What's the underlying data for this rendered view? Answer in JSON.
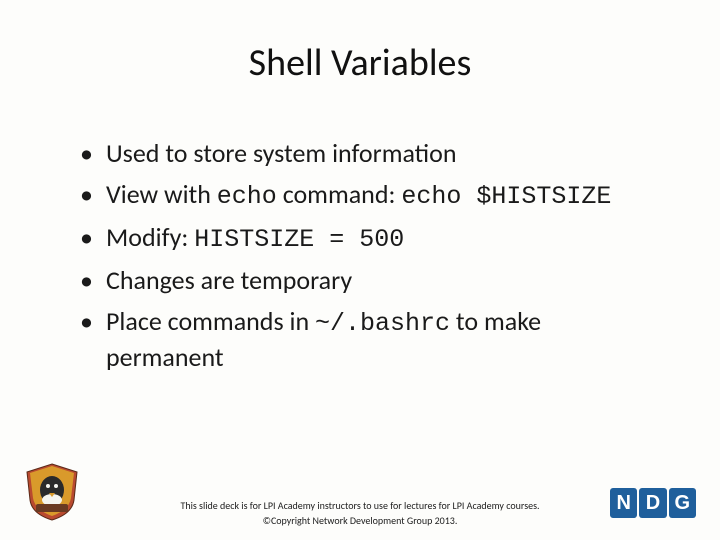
{
  "title": "Shell Variables",
  "bullets": [
    {
      "pre": "Used to store system information",
      "code1": "",
      "mid": "",
      "code2": "",
      "post": ""
    },
    {
      "pre": "View with ",
      "code1": "echo",
      "mid": " command: ",
      "code2": "echo $HISTSIZE",
      "post": ""
    },
    {
      "pre": "Modify: ",
      "code1": "HISTSIZE = 500",
      "mid": "",
      "code2": "",
      "post": ""
    },
    {
      "pre": "Changes are temporary",
      "code1": "",
      "mid": "",
      "code2": "",
      "post": ""
    },
    {
      "pre": "Place commands in ",
      "code1": "~/.bashrc",
      "mid": "",
      "code2": "",
      "post": " to make permanent"
    }
  ],
  "footer": {
    "line1": "This slide deck is for LPI Academy instructors to use for lectures for LPI Academy courses.",
    "line2": "©Copyright Network Development Group 2013."
  },
  "logos": {
    "left_alt": "LPI Academy shield logo",
    "ndg": [
      "N",
      "D",
      "G"
    ]
  }
}
